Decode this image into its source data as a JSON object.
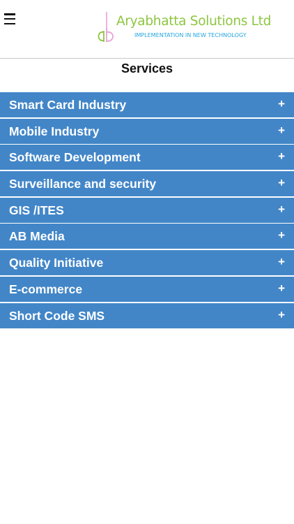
{
  "header": {
    "menu_icon": "hamburger-menu-icon",
    "logo": {
      "mark_text": "ab",
      "name": "Aryabhatta Solutions Ltd",
      "tagline": "IMPLEMENTATION IN NEW TECHNOLOGY",
      "name_color": "#8dc63f",
      "tagline_color": "#29a8e0",
      "mark_colors": [
        "#e9a0d8",
        "#8dc63f"
      ]
    }
  },
  "page": {
    "title": "Services"
  },
  "services": {
    "accent_color": "#4286c8",
    "expand_icon": "plus-icon",
    "expand_glyph": "+",
    "items": [
      {
        "label": "Smart Card Industry"
      },
      {
        "label": "Mobile Industry"
      },
      {
        "label": "Software Development"
      },
      {
        "label": "Surveillance and security"
      },
      {
        "label": "GIS /ITES"
      },
      {
        "label": "AB Media"
      },
      {
        "label": "Quality Initiative"
      },
      {
        "label": "E-commerce"
      },
      {
        "label": "Short Code SMS"
      }
    ]
  }
}
